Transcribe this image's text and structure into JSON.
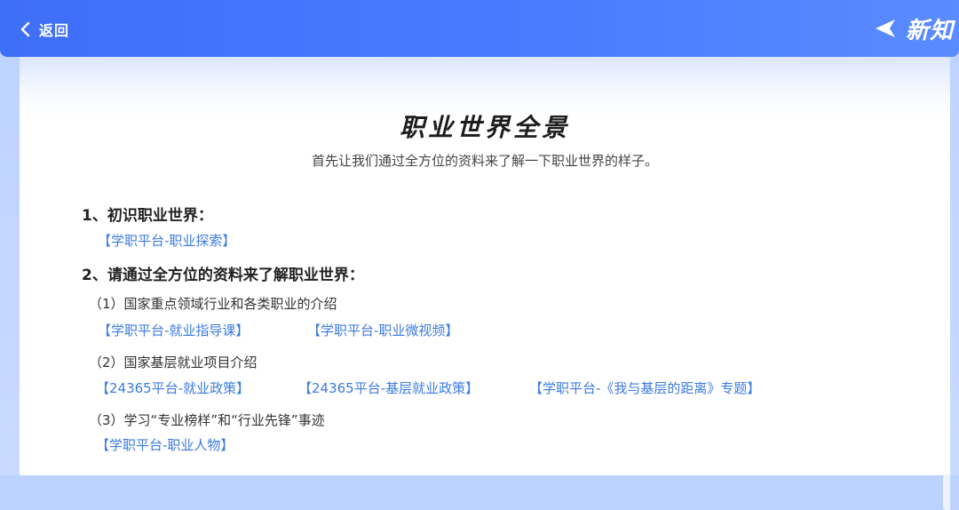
{
  "header": {
    "back_label": "返回",
    "brand_name": "新知"
  },
  "content": {
    "title": "职业世界全景",
    "subtitle": "首先让我们通过全方位的资料来了解一下职业世界的样子。",
    "section1": {
      "heading": "1、初识职业世界：",
      "links": [
        "【学职平台-职业探索】"
      ]
    },
    "section2": {
      "heading": "2、请通过全方位的资料来了解职业世界：",
      "items": [
        {
          "label": "（1）国家重点领域行业和各类职业的介绍",
          "links": [
            "【学职平台-就业指导课】",
            "【学职平台-职业微视频】"
          ]
        },
        {
          "label": "（2）国家基层就业项目介绍",
          "links": [
            "【24365平台-就业政策】",
            "【24365平台-基层就业政策】",
            "【学职平台-《我与基层的距离》专题】"
          ]
        },
        {
          "label": "（3）学习“专业榜样”和“行业先锋”事迹",
          "links": [
            "【学职平台-职业人物】"
          ]
        }
      ]
    }
  },
  "colors": {
    "header": "#4a7cff",
    "link": "#3d7be0",
    "text": "#222222"
  }
}
